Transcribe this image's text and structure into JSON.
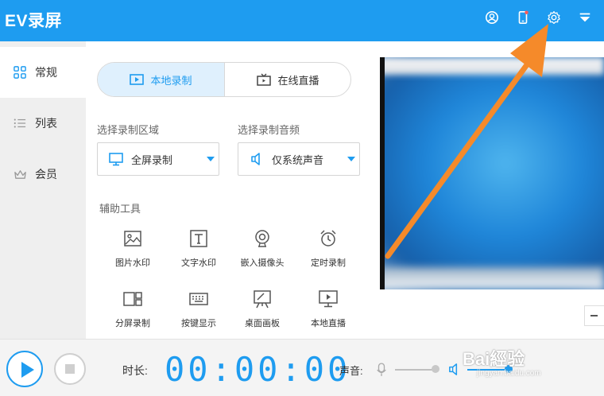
{
  "app": {
    "title": "EV录屏"
  },
  "titlebar_icons": [
    "user-icon",
    "phone-icon",
    "gear-icon",
    "dropdown-menu-icon"
  ],
  "sidebar": {
    "items": [
      {
        "label": "常规",
        "icon": "grid-icon",
        "active": true
      },
      {
        "label": "列表",
        "icon": "list-icon",
        "active": false
      },
      {
        "label": "会员",
        "icon": "crown-icon",
        "active": false
      }
    ]
  },
  "mode_tabs": [
    {
      "label": "本地录制",
      "active": true
    },
    {
      "label": "在线直播",
      "active": false
    }
  ],
  "record_area": {
    "label": "选择录制区域",
    "value": "全屏录制"
  },
  "record_audio": {
    "label": "选择录制音频",
    "value": "仅系统声音"
  },
  "tools": {
    "label": "辅助工具",
    "items": [
      {
        "label": "图片水印",
        "icon": "image-icon"
      },
      {
        "label": "文字水印",
        "icon": "text-icon"
      },
      {
        "label": "嵌入摄像头",
        "icon": "webcam-icon"
      },
      {
        "label": "定时录制",
        "icon": "alarm-clock-icon"
      },
      {
        "label": "分屏录制",
        "icon": "split-screen-icon"
      },
      {
        "label": "按键显示",
        "icon": "keyboard-icon"
      },
      {
        "label": "桌面画板",
        "icon": "easel-icon"
      },
      {
        "label": "本地直播",
        "icon": "monitor-play-icon"
      }
    ]
  },
  "bottom": {
    "duration_label": "时长:",
    "timer": "00:00:00",
    "sound_label": "声音:"
  },
  "watermark": {
    "brand": "Bai經验",
    "url": "jingyan.baidu.com"
  },
  "colors": {
    "accent": "#1e9cf0",
    "annotation_arrow": "#f58a2a"
  }
}
